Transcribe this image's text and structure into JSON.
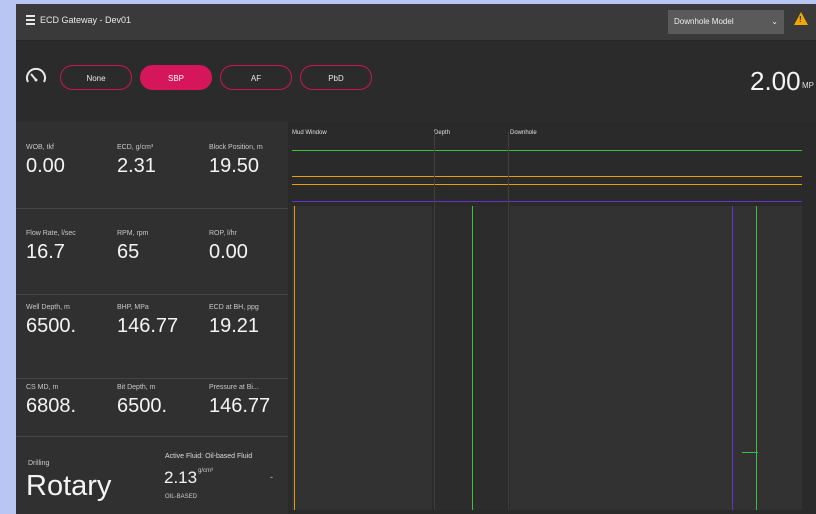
{
  "header": {
    "title": "ECD  Gateway - Dev01",
    "model_select": "Downhole Model",
    "warning_color": "#f0a800"
  },
  "modes": {
    "buttons": [
      "None",
      "SBP",
      "AF",
      "PbD"
    ],
    "active": "SBP",
    "accent_color": "#d5165b"
  },
  "pressure": {
    "value": "2.00",
    "unit": "MP"
  },
  "metrics": [
    {
      "label": "WOB, tkf",
      "value": "0.00"
    },
    {
      "label": "ECD, g/cm³",
      "value": "2.31"
    },
    {
      "label": "Block Position, m",
      "value": "19.50"
    },
    {
      "label": "Flow Rate, l/sec",
      "value": "16.7"
    },
    {
      "label": "RPM, rpm",
      "value": "65"
    },
    {
      "label": "ROP, l/hr",
      "value": "0.00"
    },
    {
      "label": "Well Depth, m",
      "value": "6500."
    },
    {
      "label": "BHP, MPa",
      "value": "146.77"
    },
    {
      "label": "ECD at BH, ppg",
      "value": "19.21"
    },
    {
      "label": "CS MD, m",
      "value": "6808."
    },
    {
      "label": "Bit Depth, m",
      "value": "6500."
    },
    {
      "label": "Pressure at Bi...",
      "value": "146.77"
    }
  ],
  "drilling": {
    "label": "Drilling",
    "value": "Rotary"
  },
  "fluid": {
    "label": "Active Fluid: Oil-based Fluid",
    "value": "2.13",
    "unit": "g/cm³",
    "type": "OIL-BASED"
  },
  "tracks": {
    "headers": [
      "Mud Window",
      "Depth",
      "Downhole"
    ],
    "colors": {
      "green": "#3fbf3f",
      "orange": "#e8a000",
      "purple": "#6a2fd0"
    }
  }
}
